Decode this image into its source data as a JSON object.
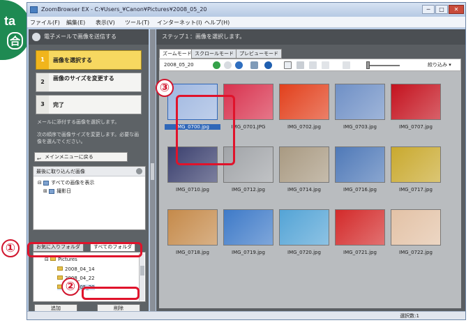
{
  "badge": {
    "line1": "ta",
    "line2": "合"
  },
  "window": {
    "title": "ZoomBrowser EX - C:¥Users_¥Canon¥Pictures¥2008_05_20",
    "buttons": {
      "minimize": "─",
      "maximize": "□",
      "close": "✕"
    }
  },
  "menu": [
    "ファイル(F)",
    "編集(E)",
    "表示(V)",
    "ツール(T)",
    "インターネット(I)",
    "ヘルプ(H)"
  ],
  "left": {
    "header": "電子メールで画像を送信する",
    "steps": [
      {
        "num": "1",
        "label": "画像を選択する"
      },
      {
        "num": "2",
        "label": "画像のサイズを変更する"
      },
      {
        "num": "3",
        "label": "完了"
      }
    ],
    "desc1": "メールに添付する画像を選択します。",
    "desc2": "次の順序で画像サイズを変更します。必要な画像を選んでください。",
    "back_button": "メインメニューに戻る",
    "recent": {
      "title": "最後に取り込んだ画像",
      "items": [
        "すべての画像を表示",
        "撮影日"
      ]
    },
    "folder_tabs": {
      "favorites": "お気に入りフォルダ",
      "all": "すべてのフォルダ"
    },
    "folders": [
      "Pictures",
      "2008_04_14",
      "2008_04_22",
      "2008_05_20"
    ],
    "buttons": {
      "add": "追加",
      "remove": "削除"
    }
  },
  "right": {
    "header": "ステップ１：画像を選択します。",
    "view_tabs": [
      "ズームモード",
      "スクロールモード",
      "プレビューモード"
    ],
    "toolbar": {
      "date": "2008_05_20",
      "filter": "絞り込み ▾"
    },
    "images": [
      {
        "name": "IMG_0700.jpg",
        "selected": true,
        "color": "#9fb7e0"
      },
      {
        "name": "IMG_0701.JPG",
        "selected": false,
        "color": "#d8324e"
      },
      {
        "name": "IMG_0702.jpg",
        "selected": false,
        "color": "#e2401c"
      },
      {
        "name": "IMG_0703.jpg",
        "selected": false,
        "color": "#6f90c6"
      },
      {
        "name": "IMG_0707.jpg",
        "selected": false,
        "color": "#c4121e"
      },
      {
        "name": "IMG_0710.jpg",
        "selected": false,
        "color": "#3a3f6e"
      },
      {
        "name": "IMG_0712.jpg",
        "selected": false,
        "color": "#a1a4a8"
      },
      {
        "name": "IMG_0714.jpg",
        "selected": false,
        "color": "#a99a82"
      },
      {
        "name": "IMG_0716.jpg",
        "selected": false,
        "color": "#4f79b8"
      },
      {
        "name": "IMG_0717.jpg",
        "selected": false,
        "color": "#c9a92e"
      },
      {
        "name": "IMG_0718.jpg",
        "selected": false,
        "color": "#c58a4a"
      },
      {
        "name": "IMG_0719.jpg",
        "selected": false,
        "color": "#3e7ac8"
      },
      {
        "name": "IMG_0720.jpg",
        "selected": false,
        "color": "#54a4d6"
      },
      {
        "name": "IMG_0721.jpg",
        "selected": false,
        "color": "#d32a2a"
      },
      {
        "name": "IMG_0722.jpg",
        "selected": false,
        "color": "#e3c2a6"
      }
    ]
  },
  "status": "選択数:1",
  "annotations": [
    "①",
    "②",
    "③"
  ]
}
